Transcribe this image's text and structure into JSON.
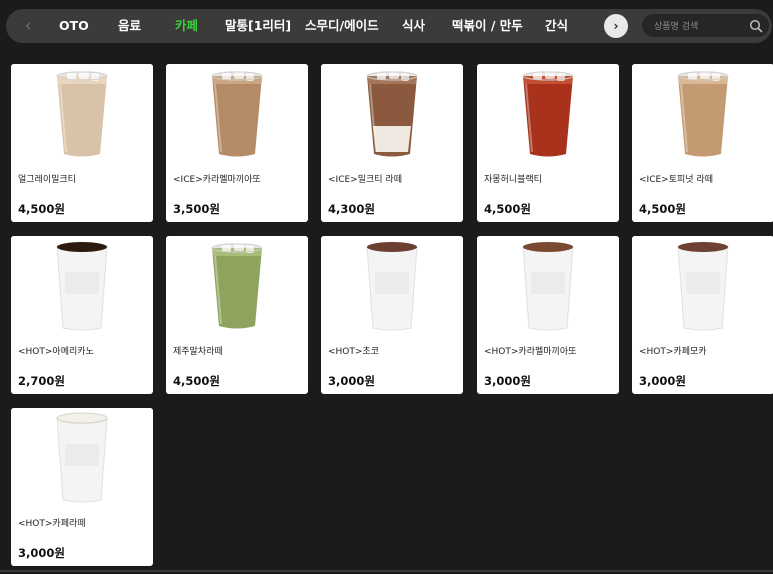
{
  "nav": {
    "tabs": [
      {
        "label": "OTO",
        "active": false
      },
      {
        "label": "음료",
        "active": false
      },
      {
        "label": "카페",
        "active": true
      },
      {
        "label": "말통[1리터]",
        "active": false
      },
      {
        "label": "스무디/에이드",
        "active": false
      },
      {
        "label": "식사",
        "active": false
      },
      {
        "label": "떡볶이 / 만두",
        "active": false
      },
      {
        "label": "간식",
        "active": false
      }
    ],
    "prev_icon": "‹",
    "next_icon": "›"
  },
  "search": {
    "placeholder": "상품명 검색",
    "value": ""
  },
  "colors": {
    "background": "#1b1b1b",
    "nav_bg": "#3b3b3b",
    "active_tab": "#3cd03c"
  },
  "products": [
    {
      "name": "얼그레이밀크티",
      "price": "4,500원",
      "image": "iced-milk-tea-cup"
    },
    {
      "name": "<ICE>카라멜마끼아또",
      "price": "3,500원",
      "image": "iced-caramel-macchiato-cup"
    },
    {
      "name": "<ICE>밀크티 라떼",
      "price": "4,300원",
      "image": "iced-milk-tea-latte-cup"
    },
    {
      "name": "자몽허니블랙티",
      "price": "4,500원",
      "image": "iced-grapefruit-black-tea-cup"
    },
    {
      "name": "<ICE>토피넛 라떼",
      "price": "4,500원",
      "image": "iced-toffee-nut-latte-cup"
    },
    {
      "name": "<HOT>아메리카노",
      "price": "2,700원",
      "image": "hot-americano-cup"
    },
    {
      "name": "제주말차라떼",
      "price": "4,500원",
      "image": "iced-matcha-latte-cup"
    },
    {
      "name": "<HOT>초코",
      "price": "3,000원",
      "image": "hot-chocolate-cup"
    },
    {
      "name": "<HOT>카라멜마끼아또",
      "price": "3,000원",
      "image": "hot-caramel-macchiato-cup"
    },
    {
      "name": "<HOT>카페모카",
      "price": "3,000원",
      "image": "hot-cafe-mocha-cup"
    },
    {
      "name": "<HOT>카페라떼",
      "price": "3,000원",
      "image": "hot-cafe-latte-cup"
    }
  ]
}
